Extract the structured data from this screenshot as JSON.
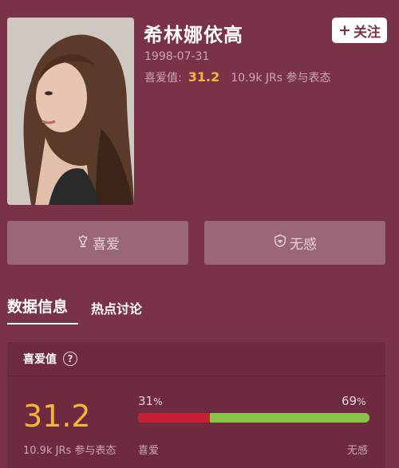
{
  "profile": {
    "name": "希林娜依高",
    "birthdate": "1998-07-31",
    "fav_label": "喜爱值:",
    "fav_value": "31.2",
    "fav_participants": "10.9k JRs 参与表态",
    "follow_label": "关注",
    "follow_icon": "plus-icon"
  },
  "actions": {
    "like_label": "喜爱",
    "like_icon": "flower-icon",
    "dislike_label": "无感",
    "dislike_icon": "shield-icon"
  },
  "tabs": [
    {
      "label": "数据信息",
      "active": true
    },
    {
      "label": "热点讨论",
      "active": false
    }
  ],
  "panel": {
    "title": "喜爱值",
    "help_icon": "question-icon",
    "value": "31.2",
    "participants": "10.9k JRs 参与表态",
    "like_pct": 31,
    "dislike_pct": 69,
    "like_pct_num": "31",
    "dislike_pct_num": "69",
    "pct_symbol": "%",
    "like_label": "喜爱",
    "dislike_label": "无感"
  },
  "colors": {
    "background": "#7a3247",
    "accent": "#f7b53a",
    "like_bar": "#c62032",
    "dislike_bar": "#8bc34a"
  }
}
